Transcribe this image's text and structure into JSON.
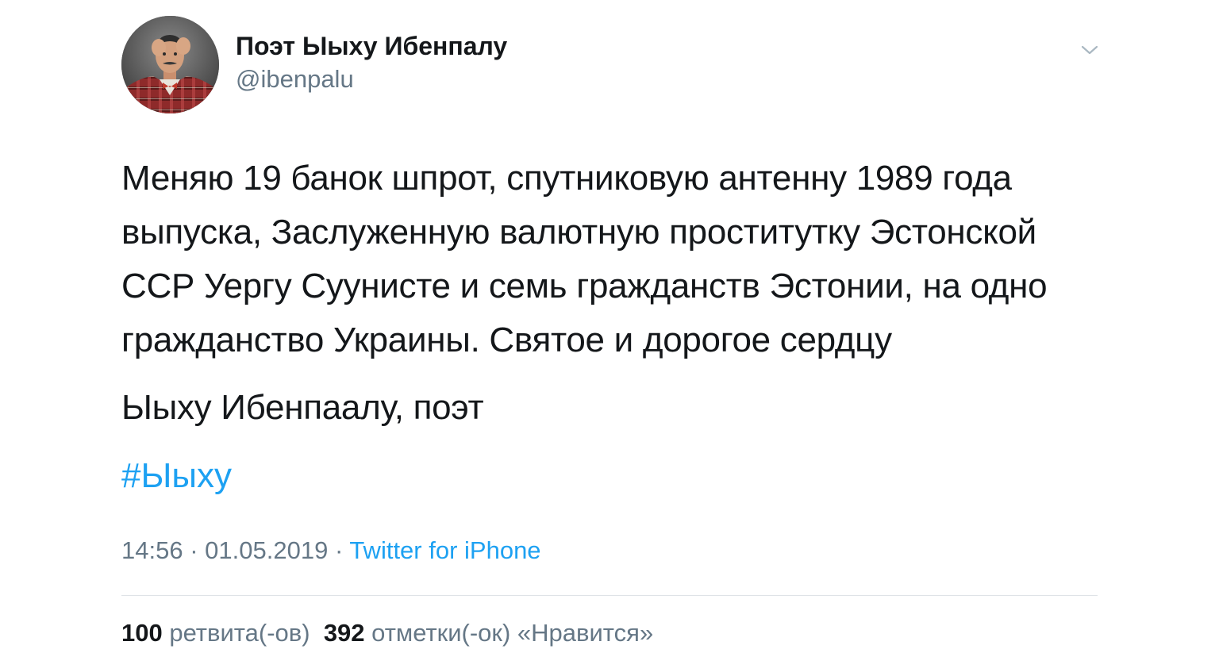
{
  "author": {
    "name": "Поэт Ыыху Ибенпалу",
    "handle": "@ibenpalu",
    "avatar_icon": "user-avatar-photo"
  },
  "menu": {
    "icon": "chevron-down-icon"
  },
  "tweet": {
    "text": "Меняю 19 банок шпрот, спутниковую антенну 1989 года выпуска, Заслуженную валютную проститутку Эстонской ССР Уергу Суунисте и семь гражданств Эстонии, на одно гражданство Украины. Святое и дорогое сердцу",
    "signature": "Ыыху Ибенпаалу, поэт",
    "hashtag": "#Ыыху"
  },
  "meta": {
    "time": "14:56",
    "separator": "·",
    "date": "01.05.2019",
    "source": "Twitter for iPhone"
  },
  "stats": {
    "retweets_count": "100",
    "retweets_label": "ретвита(-ов)",
    "likes_count": "392",
    "likes_label": "отметки(-ок) «Нравится»"
  },
  "colors": {
    "text": "#14171a",
    "secondary": "#657786",
    "accent": "#1da1f2",
    "divider": "#dfe3e7"
  }
}
